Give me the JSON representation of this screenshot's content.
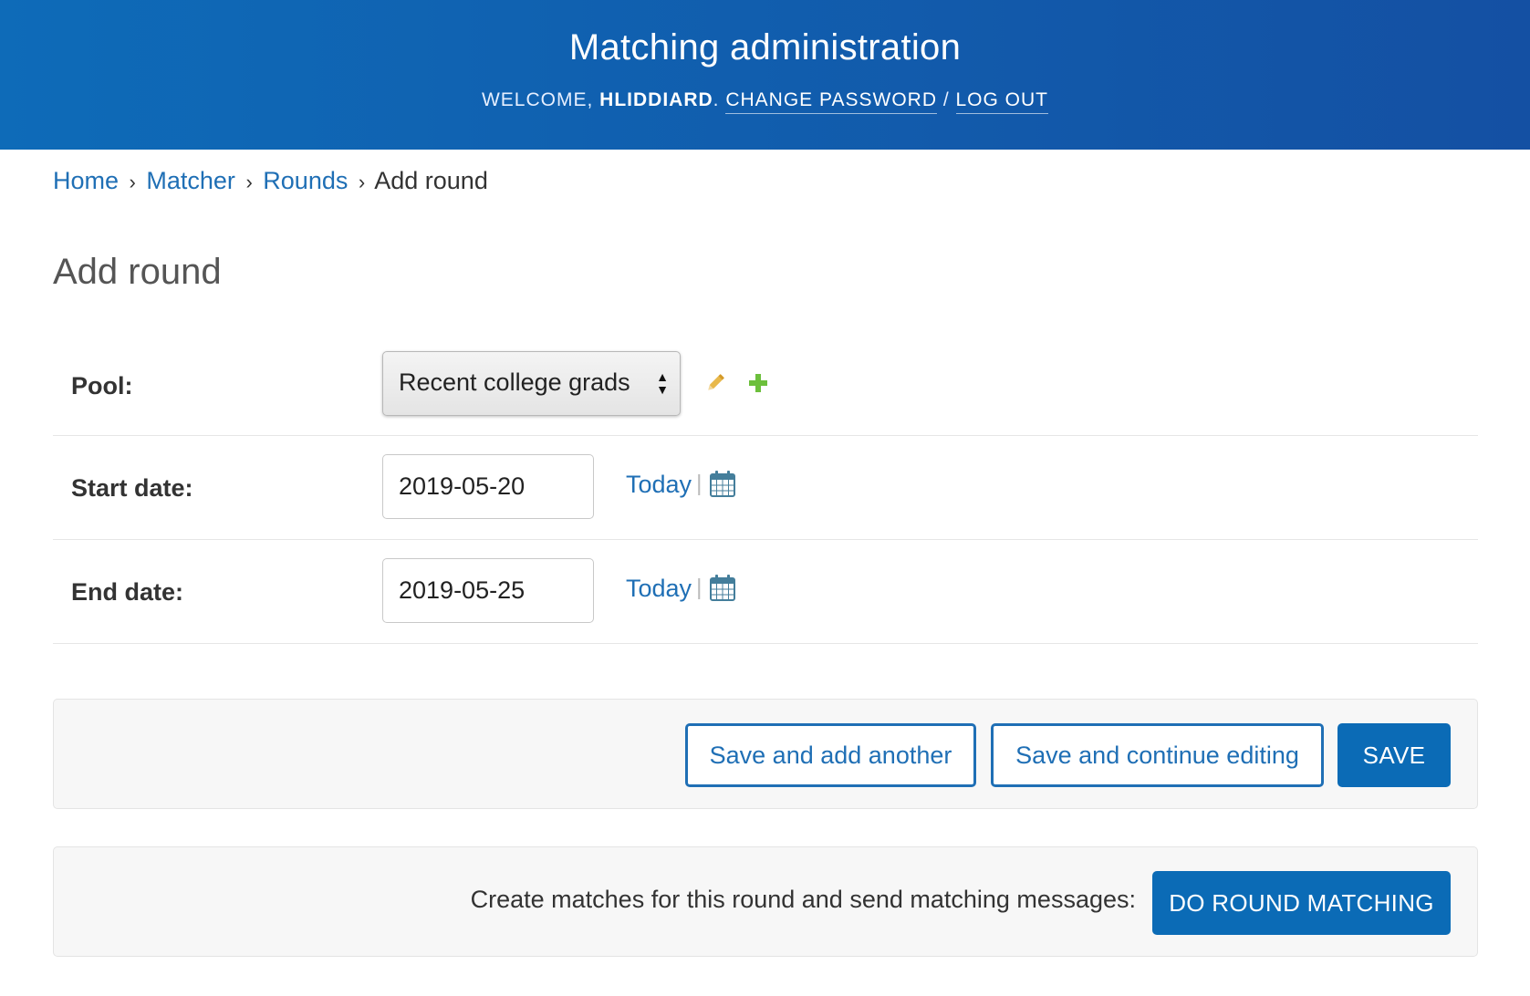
{
  "header": {
    "site_title": "Matching administration",
    "welcome_prefix": "WELCOME, ",
    "username": "HLIDDIARD",
    "after_username": ". ",
    "change_password": "CHANGE PASSWORD",
    "divider": " / ",
    "log_out": "LOG OUT"
  },
  "breadcrumbs": {
    "items": [
      "Home",
      "Matcher",
      "Rounds"
    ],
    "separator": "›",
    "current": "Add round"
  },
  "page": {
    "title": "Add round"
  },
  "form": {
    "pool": {
      "label": "Pool:",
      "value": "Recent college grads",
      "edit_icon": "pencil-icon",
      "add_icon": "plus-icon"
    },
    "start_date": {
      "label": "Start date:",
      "value": "2019-05-20",
      "today": "Today",
      "separator": "|",
      "icon": "calendar-icon"
    },
    "end_date": {
      "label": "End date:",
      "value": "2019-05-25",
      "today": "Today",
      "separator": "|",
      "icon": "calendar-icon"
    }
  },
  "submit": {
    "save_and_add_another": "Save and add another",
    "save_and_continue": "Save and continue editing",
    "save": "SAVE"
  },
  "matching": {
    "text": "Create matches for this round and send matching messages:",
    "button": "DO ROUND MATCHING"
  },
  "colors": {
    "header_start": "#0e6bb8",
    "header_end": "#1450a3",
    "link": "#1f6fb5",
    "primary_button": "#0b6bb6",
    "pencil": "#e8b84a",
    "plus": "#6cbf3c"
  }
}
